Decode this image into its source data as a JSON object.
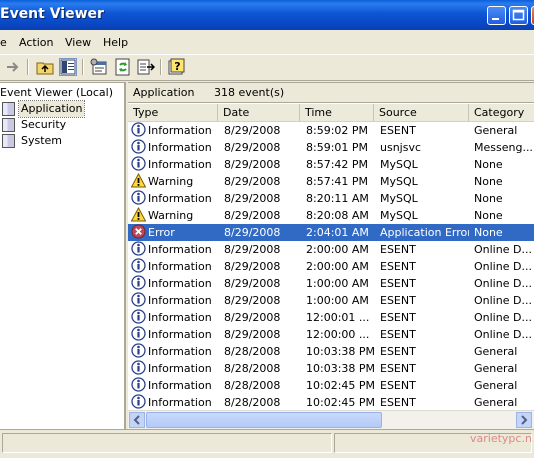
{
  "window": {
    "title": "Event Viewer",
    "controls": [
      "minimize",
      "maximize",
      "close"
    ]
  },
  "menu": {
    "items": [
      "e",
      "Action",
      "View",
      "Help"
    ]
  },
  "toolbar": {
    "icons": [
      "forward-arrow-icon",
      "up-folder-icon",
      "show-hide-tree-icon",
      "properties-icon",
      "refresh-icon",
      "export-list-icon",
      "help-icon"
    ]
  },
  "tree": {
    "root": "Event Viewer (Local)",
    "items": [
      {
        "label": "Application",
        "selected": true
      },
      {
        "label": "Security",
        "selected": false
      },
      {
        "label": "System",
        "selected": false
      }
    ]
  },
  "pane": {
    "log_name": "Application",
    "event_count": "318 event(s)"
  },
  "columns": [
    "Type",
    "Date",
    "Time",
    "Source",
    "Category"
  ],
  "rows": [
    {
      "type": "Information",
      "icon": "info",
      "date": "8/29/2008",
      "time": "8:59:02 PM",
      "source": "ESENT",
      "category": "General"
    },
    {
      "type": "Information",
      "icon": "info",
      "date": "8/29/2008",
      "time": "8:59:01 PM",
      "source": "usnjsvc",
      "category": "Messeng..."
    },
    {
      "type": "Information",
      "icon": "info",
      "date": "8/29/2008",
      "time": "8:57:42 PM",
      "source": "MySQL",
      "category": "None"
    },
    {
      "type": "Warning",
      "icon": "warning",
      "date": "8/29/2008",
      "time": "8:57:41 PM",
      "source": "MySQL",
      "category": "None"
    },
    {
      "type": "Information",
      "icon": "info",
      "date": "8/29/2008",
      "time": "8:20:11 AM",
      "source": "MySQL",
      "category": "None"
    },
    {
      "type": "Warning",
      "icon": "warning",
      "date": "8/29/2008",
      "time": "8:20:08 AM",
      "source": "MySQL",
      "category": "None"
    },
    {
      "type": "Error",
      "icon": "error",
      "date": "8/29/2008",
      "time": "2:04:01 AM",
      "source": "Application Error",
      "category": "None",
      "selected": true
    },
    {
      "type": "Information",
      "icon": "info",
      "date": "8/29/2008",
      "time": "2:00:00 AM",
      "source": "ESENT",
      "category": "Online D..."
    },
    {
      "type": "Information",
      "icon": "info",
      "date": "8/29/2008",
      "time": "2:00:00 AM",
      "source": "ESENT",
      "category": "Online D..."
    },
    {
      "type": "Information",
      "icon": "info",
      "date": "8/29/2008",
      "time": "1:00:00 AM",
      "source": "ESENT",
      "category": "Online D..."
    },
    {
      "type": "Information",
      "icon": "info",
      "date": "8/29/2008",
      "time": "1:00:00 AM",
      "source": "ESENT",
      "category": "Online D..."
    },
    {
      "type": "Information",
      "icon": "info",
      "date": "8/29/2008",
      "time": "12:00:01 ...",
      "source": "ESENT",
      "category": "Online D..."
    },
    {
      "type": "Information",
      "icon": "info",
      "date": "8/29/2008",
      "time": "12:00:00 ...",
      "source": "ESENT",
      "category": "Online D..."
    },
    {
      "type": "Information",
      "icon": "info",
      "date": "8/28/2008",
      "time": "10:03:38 PM",
      "source": "ESENT",
      "category": "General"
    },
    {
      "type": "Information",
      "icon": "info",
      "date": "8/28/2008",
      "time": "10:03:38 PM",
      "source": "ESENT",
      "category": "General"
    },
    {
      "type": "Information",
      "icon": "info",
      "date": "8/28/2008",
      "time": "10:02:45 PM",
      "source": "ESENT",
      "category": "General"
    },
    {
      "type": "Information",
      "icon": "info",
      "date": "8/28/2008",
      "time": "10:02:45 PM",
      "source": "ESENT",
      "category": "General"
    }
  ],
  "watermark": "varietypc.n",
  "colors": {
    "title_bar": "#0a47c4",
    "selection": "#316ac5",
    "chrome": "#ece9d8"
  }
}
